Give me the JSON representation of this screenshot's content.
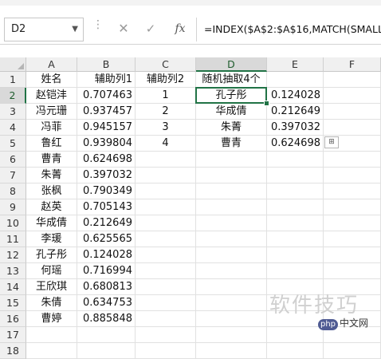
{
  "formula_bar": {
    "name_box": "D2",
    "cancel_icon": "✕",
    "enter_icon": "✓",
    "fx_label": "fx",
    "formula": "=INDEX($A$2:$A$16,MATCH(SMALL"
  },
  "columns": [
    "A",
    "B",
    "C",
    "D",
    "E",
    "F"
  ],
  "rows": [
    "1",
    "2",
    "3",
    "4",
    "5",
    "6",
    "7",
    "8",
    "9",
    "10",
    "11",
    "12",
    "13",
    "14",
    "15",
    "16",
    "17",
    "18"
  ],
  "cells": {
    "A": [
      "姓名",
      "赵铠沣",
      "冯元珊",
      "冯菲",
      "鲁红",
      "曹青",
      "朱菁",
      "张枫",
      "赵英",
      "华成倩",
      "李瑗",
      "孔子彤",
      "何瑶",
      "王欣琪",
      "朱倩",
      "曹婷"
    ],
    "B": [
      "辅助列1",
      "0.707463",
      "0.937457",
      "0.945157",
      "0.939804",
      "0.624698",
      "0.397032",
      "0.790349",
      "0.705143",
      "0.212649",
      "0.625565",
      "0.124028",
      "0.716994",
      "0.680813",
      "0.634753",
      "0.885848"
    ],
    "C": [
      "辅助列2",
      "1",
      "2",
      "3",
      "4"
    ],
    "D": [
      "随机抽取4个",
      "孔子彤",
      "华成倩",
      "朱菁",
      "曹青"
    ],
    "E": [
      "",
      "0.124028",
      "0.212649",
      "0.397032",
      "0.624698"
    ]
  },
  "selected_cell": "D2",
  "watermark": "软件技巧",
  "site_logo": {
    "badge": "php",
    "text": "中文网"
  },
  "colors": {
    "selection": "#217346",
    "header_bg": "#f0f0f0",
    "active_header_bg": "#d9d9d9"
  }
}
